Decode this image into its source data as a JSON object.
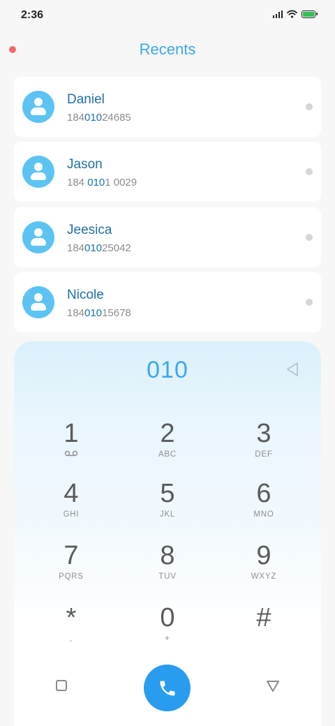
{
  "status_bar": {
    "time": "2:36"
  },
  "header": {
    "title": "Recents"
  },
  "contacts": [
    {
      "name": "Daniel",
      "number_pre": "184",
      "number_match": "010",
      "number_post": "24685"
    },
    {
      "name": "Jason",
      "number_pre": "184 ",
      "number_match": "010",
      "number_post": "1 0029"
    },
    {
      "name": "Jeesica",
      "number_pre": "184",
      "number_match": "010",
      "number_post": "25042"
    },
    {
      "name": "Nicole",
      "number_pre": "184",
      "number_match": "010",
      "number_post": "15678"
    }
  ],
  "dialer": {
    "input": "010",
    "keys": [
      {
        "digit": "1",
        "letters": ""
      },
      {
        "digit": "2",
        "letters": "ABC"
      },
      {
        "digit": "3",
        "letters": "DEF"
      },
      {
        "digit": "4",
        "letters": "GHI"
      },
      {
        "digit": "5",
        "letters": "JKL"
      },
      {
        "digit": "6",
        "letters": "MNO"
      },
      {
        "digit": "7",
        "letters": "PQRS"
      },
      {
        "digit": "8",
        "letters": "TUV"
      },
      {
        "digit": "9",
        "letters": "WXYZ"
      },
      {
        "digit": "*",
        "letters": ","
      },
      {
        "digit": "0",
        "letters": "+"
      },
      {
        "digit": "#",
        "letters": ""
      }
    ]
  },
  "colors": {
    "accent": "#3aa8ec",
    "name_blue": "#1f6fa8",
    "call_button": "#2a9cf0",
    "avatar": "#5cc3f2",
    "record_dot": "#f06a6a",
    "battery": "#2ec152"
  },
  "icons": {
    "key_1": "voicemail-icon",
    "backspace": "backspace-icon",
    "call": "phone-icon"
  }
}
